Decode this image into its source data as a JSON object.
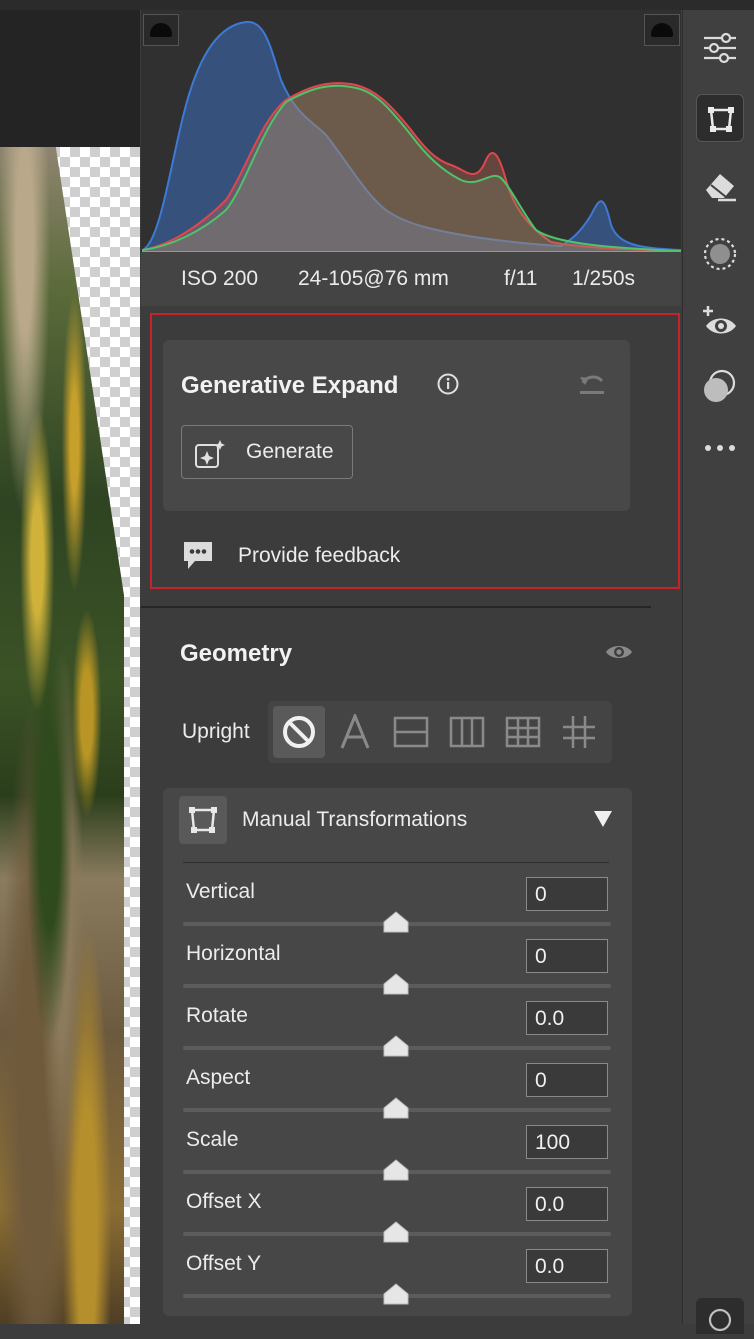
{
  "exif": {
    "iso": "ISO 200",
    "lens": "24-105@76 mm",
    "aperture": "f/11",
    "shutter": "1/250s"
  },
  "generative_expand": {
    "title": "Generative Expand",
    "generate_label": "Generate",
    "feedback_label": "Provide feedback",
    "highlight_color": "#c4242a"
  },
  "geometry": {
    "title": "Geometry",
    "upright_label": "Upright",
    "upright_options": [
      "off-icon",
      "auto-a-icon",
      "level-icon",
      "vertical-icon",
      "full-icon",
      "guided-icon"
    ],
    "manual": {
      "title": "Manual Transformations",
      "sliders": [
        {
          "label": "Vertical",
          "value": "0"
        },
        {
          "label": "Horizontal",
          "value": "0"
        },
        {
          "label": "Rotate",
          "value": "0.0"
        },
        {
          "label": "Aspect",
          "value": "0"
        },
        {
          "label": "Scale",
          "value": "100"
        },
        {
          "label": "Offset X",
          "value": "0.0"
        },
        {
          "label": "Offset Y",
          "value": "0.0"
        }
      ]
    }
  },
  "tools": [
    "edit-sliders-icon",
    "geometry-icon",
    "eraser-icon",
    "mask-icon",
    "redeye-icon",
    "presets-icon",
    "more-icon"
  ],
  "histogram_colors": {
    "blue": "#3d7ad6",
    "red": "#e0474c",
    "green": "#4fc26b"
  }
}
